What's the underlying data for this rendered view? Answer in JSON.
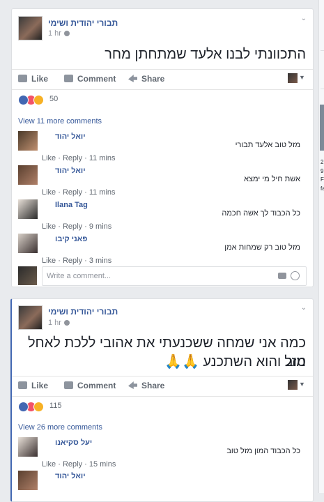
{
  "post1": {
    "author": "תבורי יהודית ושימי",
    "time": "1 hr",
    "text": "התכוונתי לבנו אלעד שמתחתן מחר",
    "actions": {
      "like": "Like",
      "comment": "Comment",
      "share": "Share"
    },
    "reactions_count": "50",
    "view_more": "View 11 more comments",
    "comments": [
      {
        "name": "יואל יהוד",
        "text": "מזל טוב אלעד תבורי",
        "actions": "Like · Reply · 11 mins"
      },
      {
        "name": "יואל יהוד",
        "text": "אשת חיל מי ימצא",
        "actions": "Like · Reply · 11 mins"
      },
      {
        "name": "Ilana Tag",
        "text": "כל הכבוד לך אשה חכמה",
        "actions": "Like · Reply · 9 mins"
      },
      {
        "name": "פאני קיבו",
        "text": "מזל טוב רק שמחות אמן",
        "actions": "Like · Reply · 3 mins"
      }
    ],
    "compose_placeholder": "Write a comment..."
  },
  "post2": {
    "author": "תבורי יהודית ושימי",
    "time": "1 hr",
    "text_line1": "כמה אני שמחה ששכנעתי את אהובי ללכת לאחל מזל",
    "text_line2": "טוב והוא השתכנע 🙏🙏",
    "actions": {
      "like": "Like",
      "comment": "Comment",
      "share": "Share"
    },
    "reactions_count": "115",
    "view_more": "View 26 more comments",
    "comments": [
      {
        "name": "יעל סקיאנו",
        "text": "כל הכבוד המון מזל טוב",
        "actions": "Like · Reply · 15 mins"
      },
      {
        "name": "יואל יהוד",
        "text": "",
        "actions": ""
      }
    ]
  },
  "sidebar": {
    "frag1": "2",
    "frag2": "9",
    "frag3": "F",
    "frag4": "fa"
  },
  "colors": {
    "link": "#365899",
    "accent": "#4267b2",
    "bg": "#e9ebee"
  }
}
